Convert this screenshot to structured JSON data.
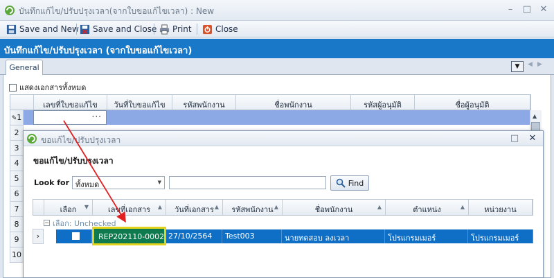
{
  "window": {
    "title": "บันทึกแก้ไข/ปรับปรุงเวลา(จากใบขอแก้ไขเวลา) : New",
    "minimize_glyph": "–",
    "restore_glyph": "□",
    "close_glyph": "✕"
  },
  "toolbar": {
    "save_new": "Save and New",
    "save_close": "Save and Close",
    "print": "Print",
    "close": "Close"
  },
  "banner": {
    "title": "บันทึกแก้ไข/ปรับปรุงเวลา (จากใบขอแก้ไขเวลา)"
  },
  "tabs": {
    "general": "General"
  },
  "show_all": {
    "label": "แสดงเอกสารทั้งหมด",
    "checked": false
  },
  "main_grid": {
    "columns": [
      "เลขที่ใบขอแก้ไข",
      "วันที่ใบขอแก้ไข",
      "รหัสพนักงาน",
      "ชื่อพนักงาน",
      "รหัสผู้อนุมัติ",
      "ชื่อผู้อนุมัติ"
    ],
    "row_numbers": [
      "1",
      "2",
      "3",
      "4",
      "5",
      "6",
      "7",
      "8",
      "9",
      "10"
    ],
    "edit_cell_value": "···"
  },
  "dialog": {
    "title": "ขอแก้ไข/ปรับปรุงเวลา",
    "heading": "ขอแก้ไข/ปรับปรุงเวลา",
    "look_for_label": "Look for",
    "look_for_value": "ทั้งหมด",
    "search_value": "",
    "find_label": "Find",
    "columns": [
      "เลือก",
      "เลขที่เอกสาร",
      "วันที่เอกสาร",
      "รหัสพนักงาน",
      "ชื่อพนักงาน",
      "ตำแหน่ง",
      "หน่วยงาน"
    ],
    "group_label": "เลือก: Unchecked",
    "row": {
      "selected": false,
      "doc_no": "REP202110-0002",
      "doc_date": "27/10/2564",
      "emp_code": "Test003",
      "emp_name": "นายทดสอบ ลงเวลา",
      "position": "โปรแกรมเมอร์",
      "department": "โปรแกรมเมอร์"
    }
  },
  "colors": {
    "banner": "#1a78c9",
    "selected_row": "#0f6fc6",
    "highlight_box": "#e2d21e",
    "arrow": "#e02020"
  }
}
